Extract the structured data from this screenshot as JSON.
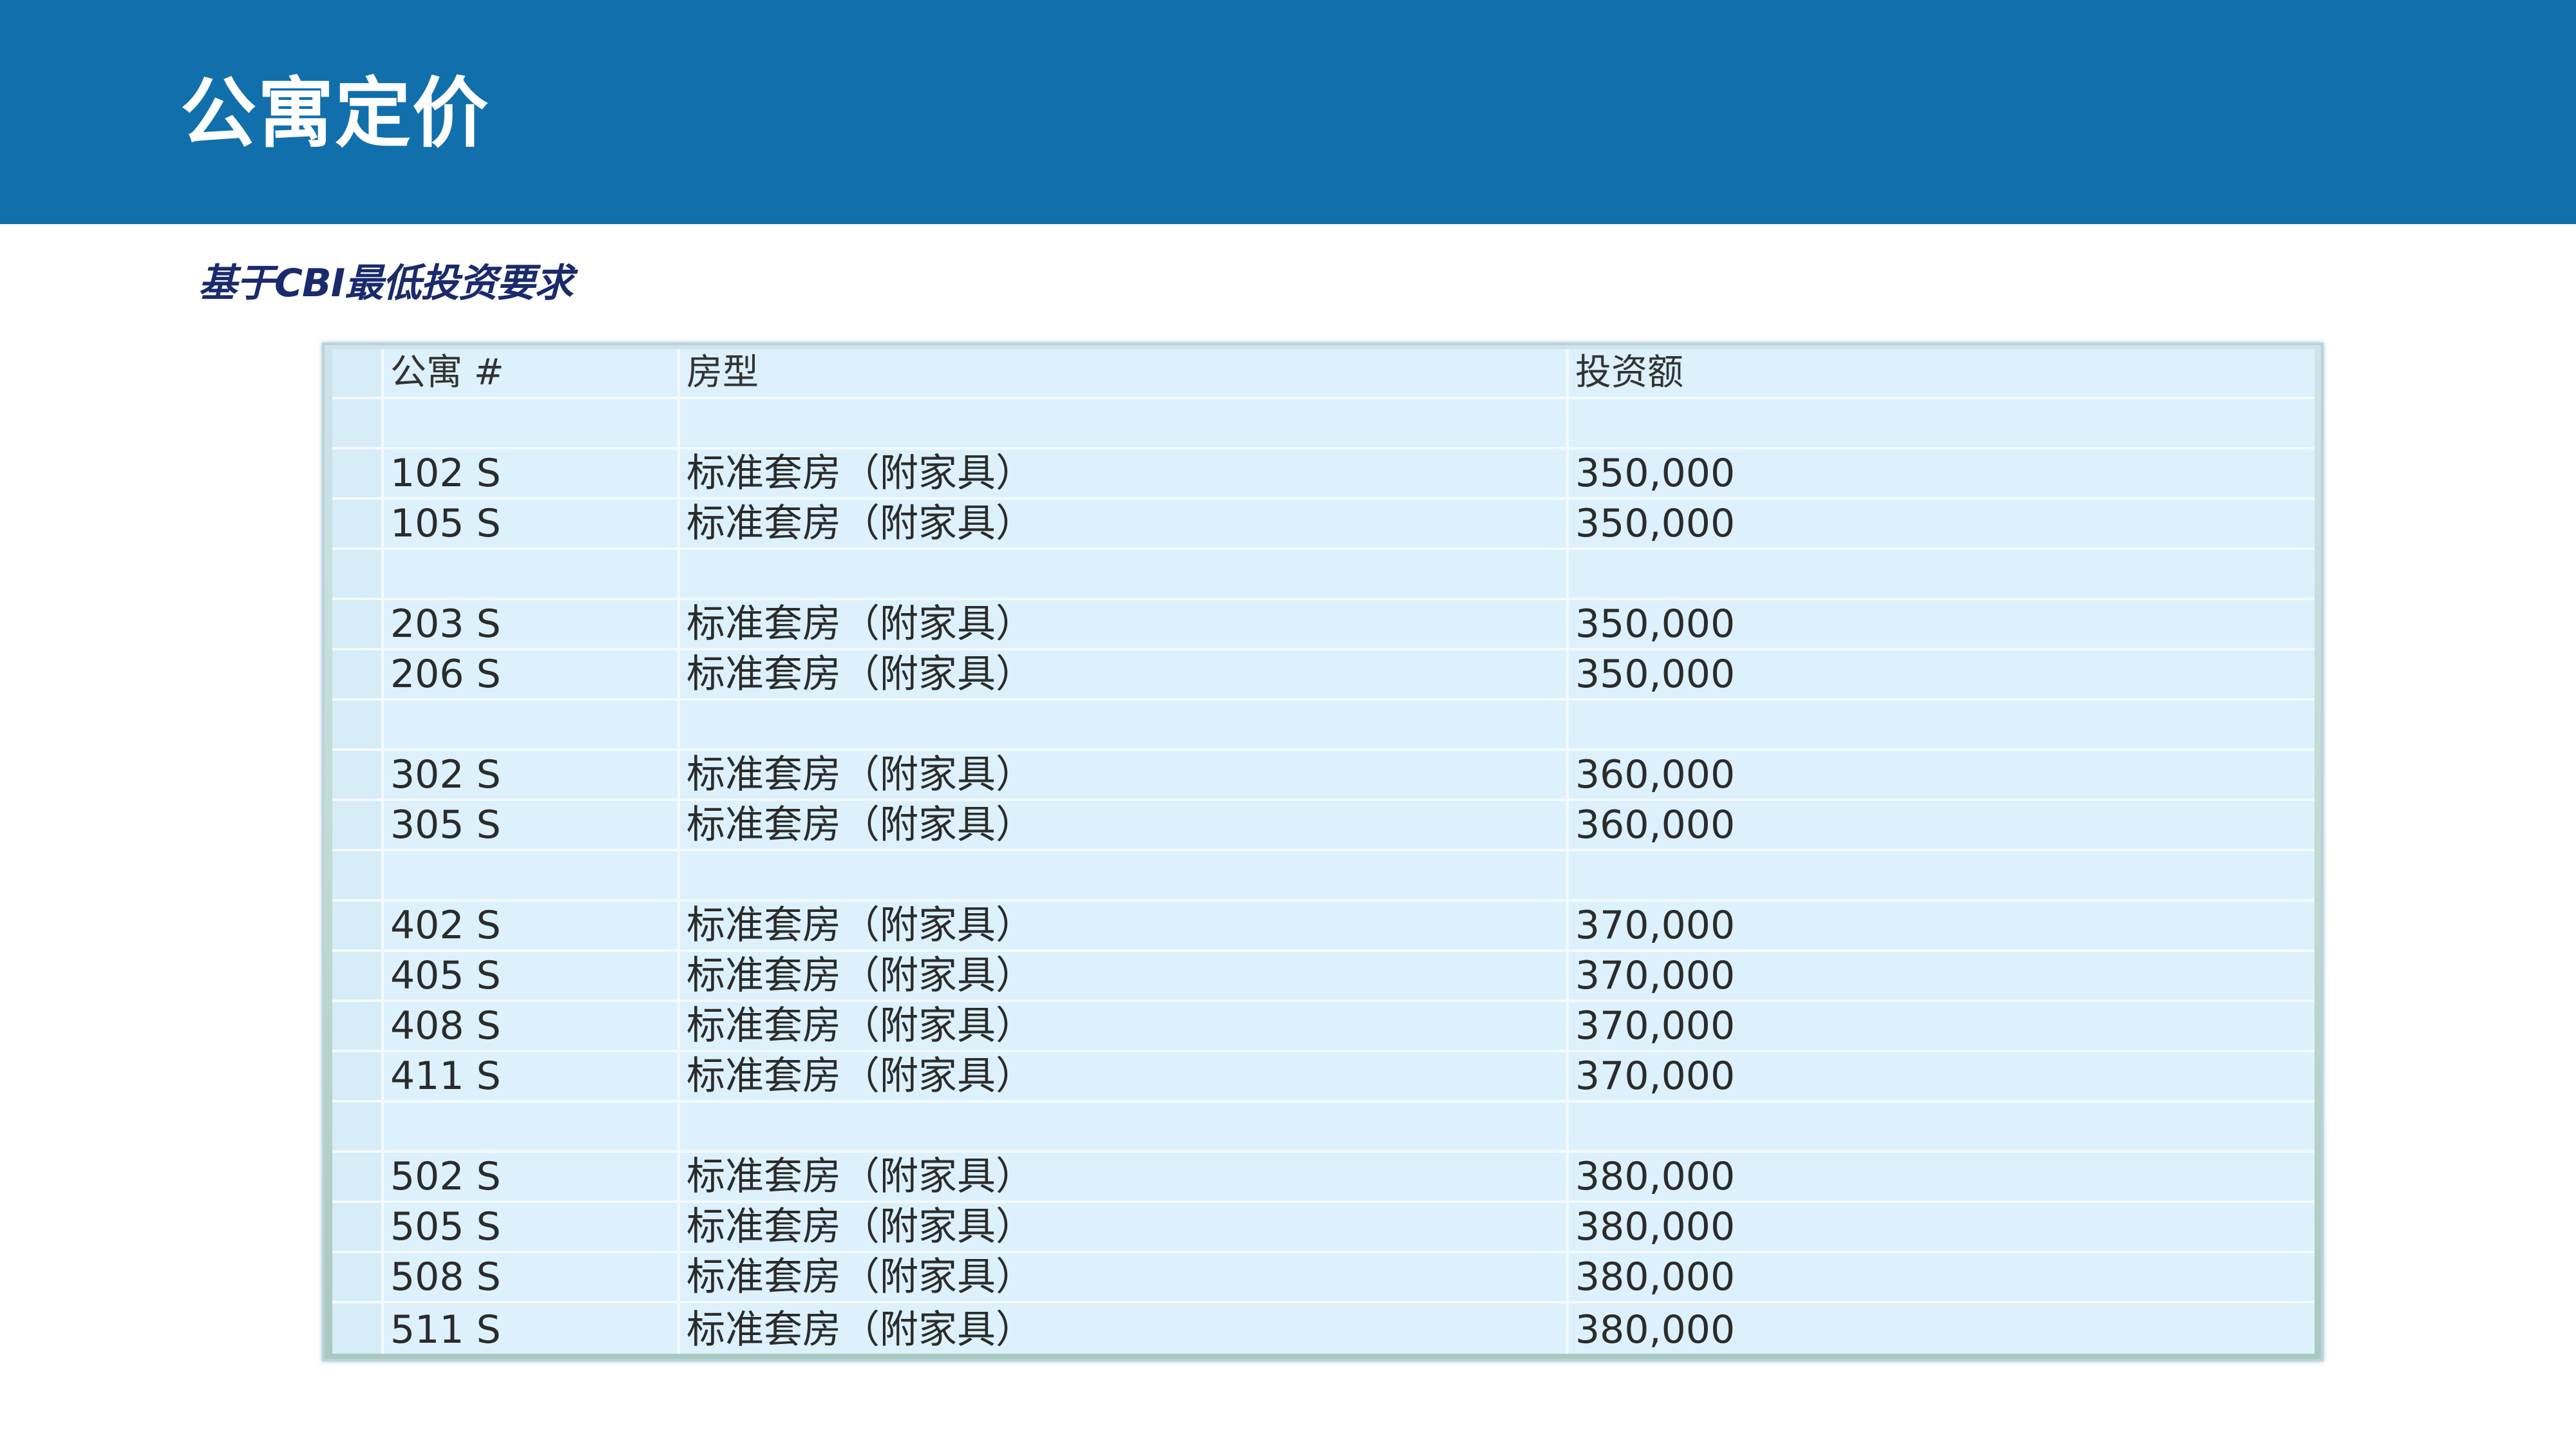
{
  "slide": {
    "title": "公寓定价",
    "subtitle": "基于CBI最低投资要求"
  },
  "table": {
    "headers": {
      "apartment": "公寓 #",
      "room_type": "房型",
      "investment": "投资额"
    },
    "rows": [
      {
        "apartment": "",
        "room_type": "",
        "investment": ""
      },
      {
        "apartment": "102 S",
        "room_type": "标准套房（附家具）",
        "investment": "350,000"
      },
      {
        "apartment": "105 S",
        "room_type": "标准套房（附家具）",
        "investment": "350,000"
      },
      {
        "apartment": "",
        "room_type": "",
        "investment": ""
      },
      {
        "apartment": "203 S",
        "room_type": "标准套房（附家具）",
        "investment": "350,000"
      },
      {
        "apartment": "206 S",
        "room_type": "标准套房（附家具）",
        "investment": "350,000"
      },
      {
        "apartment": "",
        "room_type": "",
        "investment": ""
      },
      {
        "apartment": "302 S",
        "room_type": "标准套房（附家具）",
        "investment": "360,000"
      },
      {
        "apartment": "305 S",
        "room_type": "标准套房（附家具）",
        "investment": "360,000"
      },
      {
        "apartment": "",
        "room_type": "",
        "investment": ""
      },
      {
        "apartment": "402 S",
        "room_type": "标准套房（附家具）",
        "investment": "370,000"
      },
      {
        "apartment": "405 S",
        "room_type": "标准套房（附家具）",
        "investment": "370,000"
      },
      {
        "apartment": "408 S",
        "room_type": "标准套房（附家具）",
        "investment": "370,000"
      },
      {
        "apartment": "411 S",
        "room_type": "标准套房（附家具）",
        "investment": "370,000"
      },
      {
        "apartment": "",
        "room_type": "",
        "investment": ""
      },
      {
        "apartment": "502 S",
        "room_type": "标准套房（附家具）",
        "investment": "380,000"
      },
      {
        "apartment": "505 S",
        "room_type": "标准套房（附家具）",
        "investment": "380,000"
      },
      {
        "apartment": "508 S",
        "room_type": "标准套房（附家具）",
        "investment": "380,000"
      },
      {
        "apartment": "511 S",
        "room_type": "标准套房（附家具）",
        "investment": "380,000"
      }
    ]
  },
  "colors": {
    "header_band": "#116fac",
    "subtitle_text": "#1a2a6c",
    "cell_background": "#dcf1fb"
  }
}
